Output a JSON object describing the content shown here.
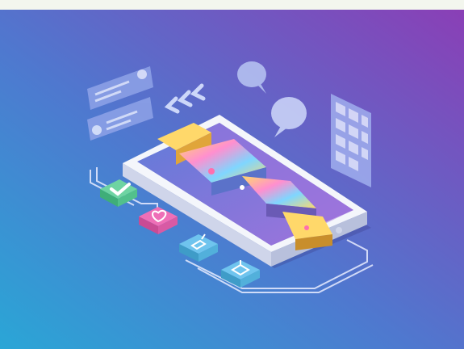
{
  "illustration": {
    "gradient": {
      "top_left": "#5a6fd6",
      "bottom_left": "#2aa6d6",
      "top_right": "#8a3fb6",
      "bottom_right": "#5b5db8"
    },
    "phone": {
      "body_color": "#f4f6fb",
      "screen_color": "#7b63c9",
      "screen_accent": "#a173dc"
    },
    "icons": [
      {
        "name": "checkmark",
        "color": "#6ed4a2"
      },
      {
        "name": "heart",
        "color": "#ee6fb7"
      },
      {
        "name": "thumbs-up",
        "color": "#6fc4ee"
      },
      {
        "name": "gift",
        "color": "#6fc4ee"
      }
    ],
    "decor": {
      "chat_bubbles": [
        "speech-bubble",
        "speech-bubble"
      ],
      "profile_cards": [
        "profile-card",
        "profile-card"
      ],
      "keypad_grid": "keypad-grid",
      "chevrons": "chevrons-left"
    }
  }
}
